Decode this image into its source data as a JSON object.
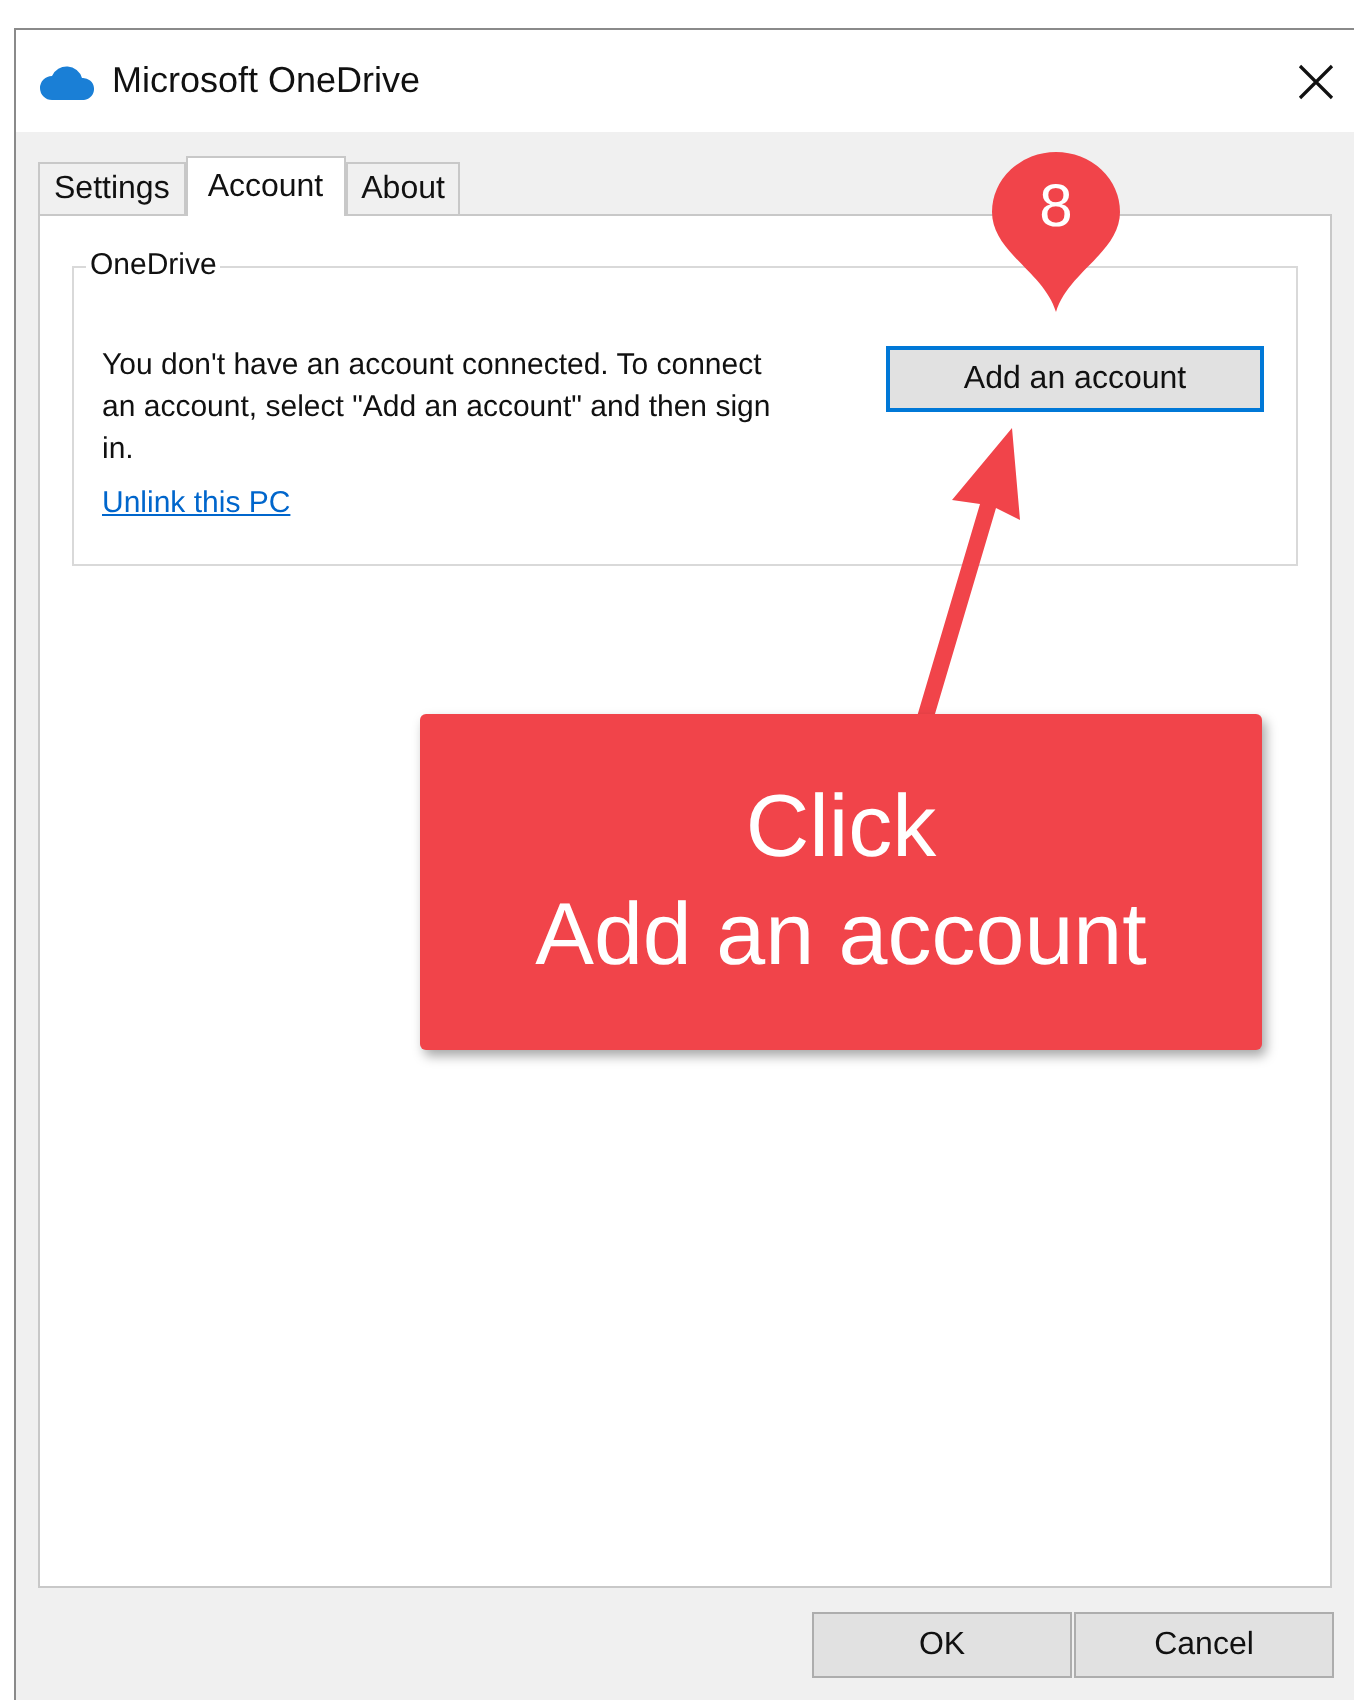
{
  "window": {
    "title": "Microsoft OneDrive"
  },
  "tabs": [
    {
      "label": "Settings",
      "selected": false
    },
    {
      "label": "Account",
      "selected": true
    },
    {
      "label": "About",
      "selected": false
    }
  ],
  "group": {
    "title": "OneDrive",
    "message": "You don't have an account connected. To connect an account, select \"Add an account\" and then sign in.",
    "link": "Unlink this PC",
    "button": {
      "label": "Add an account",
      "focused": true
    }
  },
  "buttons": [
    "OK",
    "Cancel"
  ],
  "annotation": {
    "step": "8",
    "callout_lines": [
      "Click",
      "Add an account"
    ]
  }
}
